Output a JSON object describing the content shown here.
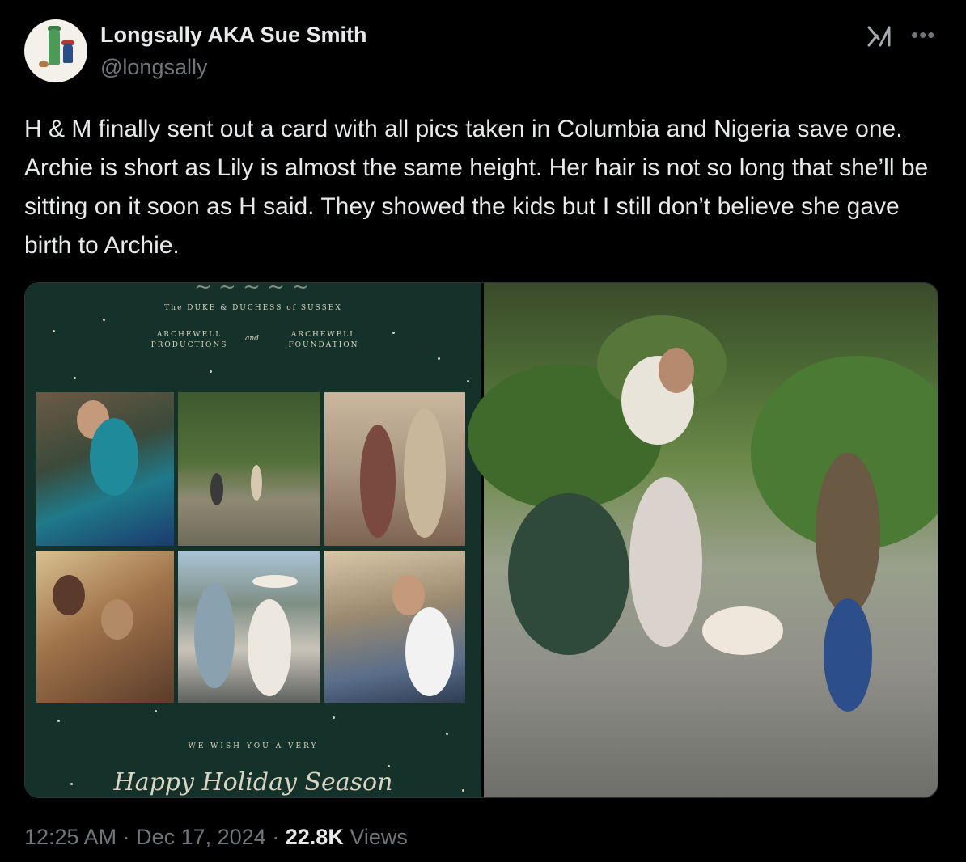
{
  "author": {
    "display_name": "Longsally AKA Sue Smith",
    "handle": "@longsally"
  },
  "icons": {
    "grok": "grok-icon",
    "more": "more-icon"
  },
  "tweet": {
    "text": "H & M finally sent out a card with all pics taken in Columbia and Nigeria save one. Archie is short as Lily is almost the same height. Her hair is not so long that she’ll be sitting on it soon as H said. They showed the kids but I still don’t believe she gave birth to Archie."
  },
  "card": {
    "duke_line": "The DUKE & DUCHESS of SUSSEX",
    "archewell_productions": "ARCHEWELL PRODUCTIONS",
    "and": "and",
    "archewell_foundation": "ARCHEWELL FOUNDATION",
    "wish_line": "WE WISH YOU A VERY",
    "season_line": "Happy Holiday Season"
  },
  "meta": {
    "time": "12:25 AM",
    "separator": "·",
    "date": "Dec 17, 2024",
    "views_count": "22.8K",
    "views_label": "Views"
  },
  "colors": {
    "background": "#000000",
    "text_primary": "#e7e9ea",
    "text_secondary": "#71767b",
    "card_green": "#14322a"
  }
}
